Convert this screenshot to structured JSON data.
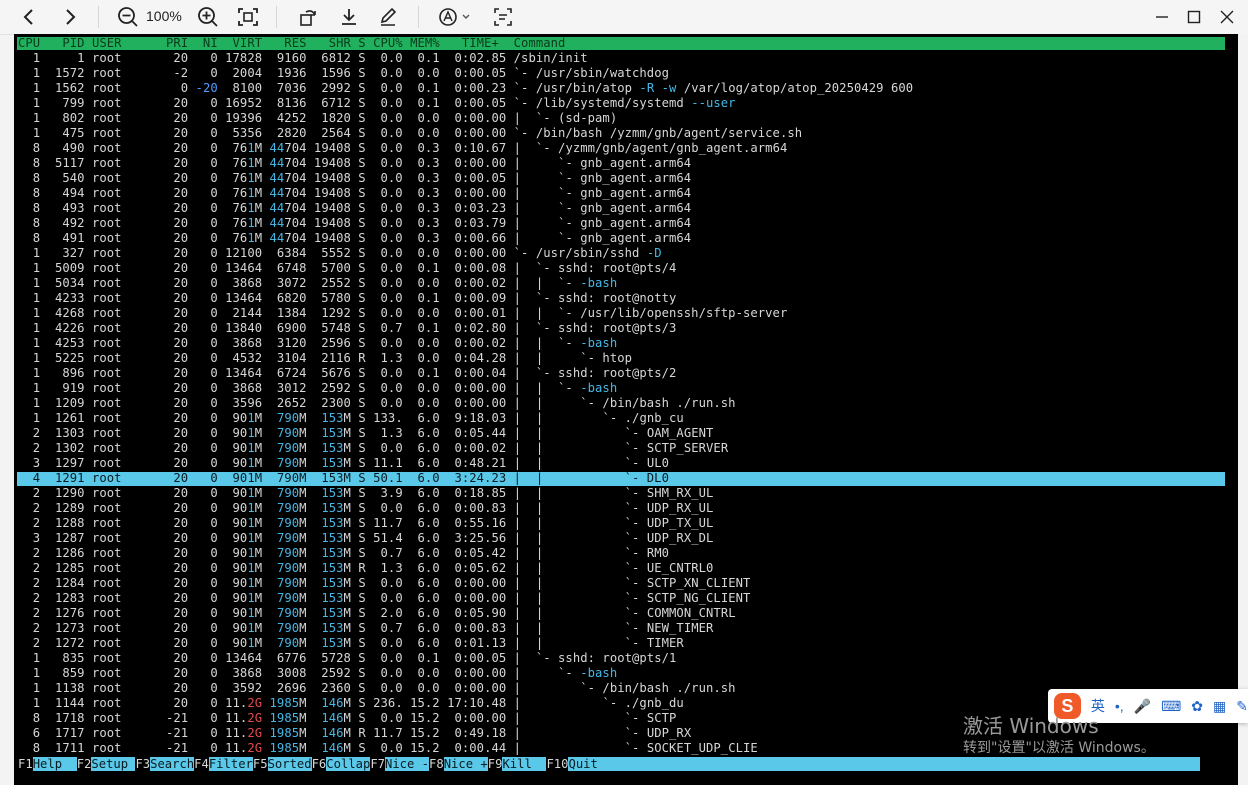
{
  "toolbar": {
    "zoom_level": "100%",
    "icons": [
      "back-icon",
      "forward-icon",
      "zoom-out-icon",
      "zoom-in-icon",
      "fit-screen-icon",
      "rotate-icon",
      "download-icon",
      "edit-icon",
      "annotate-icon",
      "crop-icon",
      "minimize-icon",
      "maximize-icon",
      "close-icon"
    ]
  },
  "htop": {
    "header": "CPU   PID USER      PRI  NI  VIRT   RES   SHR S CPU% MEM%   TIME+  Command",
    "rows": [
      "  1     1 root       20   0 17828  9160  6812 S  0.0  0.1  0:02.85 /sbin/init",
      "  1  1572 root       -2   0  2004  1936  1596 S  0.0  0.0  0:00.05 `- /usr/sbin/watchdog",
      "  1  1562 root        0 -20  8100  7036  2992 S  0.0  0.1  0:00.23 `- /usr/bin/atop -R -w /var/log/atop/atop_20250429 600",
      "  1   799 root       20   0 16952  8136  6712 S  0.0  0.1  0:00.05 `- /lib/systemd/systemd --user",
      "  1   802 root       20   0 19396  4252  1820 S  0.0  0.0  0:00.00 |  `- (sd-pam)",
      "  1   475 root       20   0  5356  2820  2564 S  0.0  0.0  0:00.00 `- /bin/bash /yzmm/gnb/agent/service.sh",
      "  8   490 root       20   0  761M 44704 19408 S  0.0  0.3  0:10.67 |  `- /yzmm/gnb/agent/gnb_agent.arm64",
      "  8  5117 root       20   0  761M 44704 19408 S  0.0  0.3  0:00.00 |     `- gnb_agent.arm64",
      "  8   540 root       20   0  761M 44704 19408 S  0.0  0.3  0:00.05 |     `- gnb_agent.arm64",
      "  8   494 root       20   0  761M 44704 19408 S  0.0  0.3  0:00.00 |     `- gnb_agent.arm64",
      "  8   493 root       20   0  761M 44704 19408 S  0.0  0.3  0:03.23 |     `- gnb_agent.arm64",
      "  8   492 root       20   0  761M 44704 19408 S  0.0  0.3  0:03.79 |     `- gnb_agent.arm64",
      "  8   491 root       20   0  761M 44704 19408 S  0.0  0.3  0:00.66 |     `- gnb_agent.arm64",
      "  1   327 root       20   0 12100  6384  5552 S  0.0  0.0  0:00.00 `- /usr/sbin/sshd -D",
      "  1  5009 root       20   0 13464  6748  5700 S  0.0  0.1  0:00.08 |  `- sshd: root@pts/4",
      "  1  5034 root       20   0  3868  3072  2552 S  0.0  0.0  0:00.02 |  |  `- -bash",
      "  1  4233 root       20   0 13464  6820  5780 S  0.0  0.1  0:00.09 |  `- sshd: root@notty",
      "  1  4268 root       20   0  2144  1384  1292 S  0.0  0.0  0:00.01 |  |  `- /usr/lib/openssh/sftp-server",
      "  1  4226 root       20   0 13840  6900  5748 S  0.7  0.1  0:02.80 |  `- sshd: root@pts/3",
      "  1  4253 root       20   0  3868  3120  2596 S  0.0  0.0  0:00.02 |  |  `- -bash",
      "  1  5225 root       20   0  4532  3104  2116 R  1.3  0.0  0:04.28 |  |     `- htop",
      "  1   896 root       20   0 13464  6724  5676 S  0.0  0.1  0:00.04 |  `- sshd: root@pts/2",
      "  1   919 root       20   0  3868  3012  2592 S  0.0  0.0  0:00.00 |  |  `- -bash",
      "  1  1209 root       20   0  3596  2652  2300 S  0.0  0.0  0:00.00 |  |     `- /bin/bash ./run.sh",
      "  1  1261 root       20   0  901M  790M  153M S 133.  6.0  9:18.03 |  |        `- ./gnb_cu",
      "  2  1303 root       20   0  901M  790M  153M S  1.3  6.0  0:05.44 |  |           `- OAM_AGENT",
      "  2  1302 root       20   0  901M  790M  153M S  0.0  6.0  0:00.02 |  |           `- SCTP_SERVER",
      "  3  1297 root       20   0  901M  790M  153M S 11.1  6.0  0:48.21 |  |           `- UL0",
      "  4  1291 root       20   0  901M  790M  153M S 50.1  6.0  3:24.23 |  |           `- DL0",
      "  2  1290 root       20   0  901M  790M  153M S  3.9  6.0  0:18.85 |  |           `- SHM_RX_UL",
      "  2  1289 root       20   0  901M  790M  153M S  0.0  6.0  0:00.83 |  |           `- UDP_RX_UL",
      "  2  1288 root       20   0  901M  790M  153M S 11.7  6.0  0:55.16 |  |           `- UDP_TX_UL",
      "  3  1287 root       20   0  901M  790M  153M S 51.4  6.0  3:25.56 |  |           `- UDP_RX_DL",
      "  2  1286 root       20   0  901M  790M  153M S  0.7  6.0  0:05.42 |  |           `- RM0",
      "  2  1285 root       20   0  901M  790M  153M R  1.3  6.0  0:05.62 |  |           `- UE_CNTRL0",
      "  2  1284 root       20   0  901M  790M  153M S  0.0  6.0  0:00.00 |  |           `- SCTP_XN_CLIENT",
      "  2  1283 root       20   0  901M  790M  153M S  0.0  6.0  0:00.00 |  |           `- SCTP_NG_CLIENT",
      "  2  1276 root       20   0  901M  790M  153M S  2.0  6.0  0:05.90 |  |           `- COMMON_CNTRL",
      "  2  1273 root       20   0  901M  790M  153M S  0.7  6.0  0:00.83 |  |           `- NEW_TIMER",
      "  2  1272 root       20   0  901M  790M  153M S  0.0  6.0  0:01.13 |  |           `- TIMER",
      "  1   835 root       20   0 13464  6776  5728 S  0.0  0.1  0:00.05 |  `- sshd: root@pts/1",
      "  1   859 root       20   0  3868  3008  2592 S  0.0  0.0  0:00.00 |     `- -bash",
      "  1  1138 root       20   0  3592  2696  2360 S  0.0  0.0  0:00.00 |        `- /bin/bash ./run.sh",
      "  1  1144 root       20   0 11.2G 1985M  146M S 236. 15.2 17:10.48 |           `- ./gnb_du",
      "  8  1718 root      -21   0 11.2G 1985M  146M S  0.0 15.2  0:00.00 |              `- SCTP",
      "  6  1717 root      -21   0 11.2G 1985M  146M R 11.7 15.2  0:49.18 |              `- UDP_RX",
      "  8  1711 root      -21   0 11.2G 1985M  146M S  0.0 15.2  0:00.44 |              `- SOCKET_UDP_CLIE"
    ],
    "selected_row": 28,
    "function_keys": [
      {
        "key": "F1",
        "label": "Help  "
      },
      {
        "key": "F2",
        "label": "Setup "
      },
      {
        "key": "F3",
        "label": "Search"
      },
      {
        "key": "F4",
        "label": "Filter"
      },
      {
        "key": "F5",
        "label": "Sorted"
      },
      {
        "key": "F6",
        "label": "Collap"
      },
      {
        "key": "F7",
        "label": "Nice -"
      },
      {
        "key": "F8",
        "label": "Nice +"
      },
      {
        "key": "F9",
        "label": "Kill  "
      },
      {
        "key": "F10",
        "label": "Quit                                                                                  "
      }
    ]
  },
  "ime": {
    "logo": "S",
    "lang": "英",
    "punct": "•,"
  },
  "watermark": {
    "title": "激活 Windows",
    "subtitle": "转到\"设置\"以激活 Windows。"
  },
  "colors": {
    "header_bg": "#21b15e",
    "selected_bg": "#5ac8e8",
    "tree_green": "#3fbf6a",
    "number_cyan": "#46b6e4",
    "negative_red": "#e24b4b"
  }
}
